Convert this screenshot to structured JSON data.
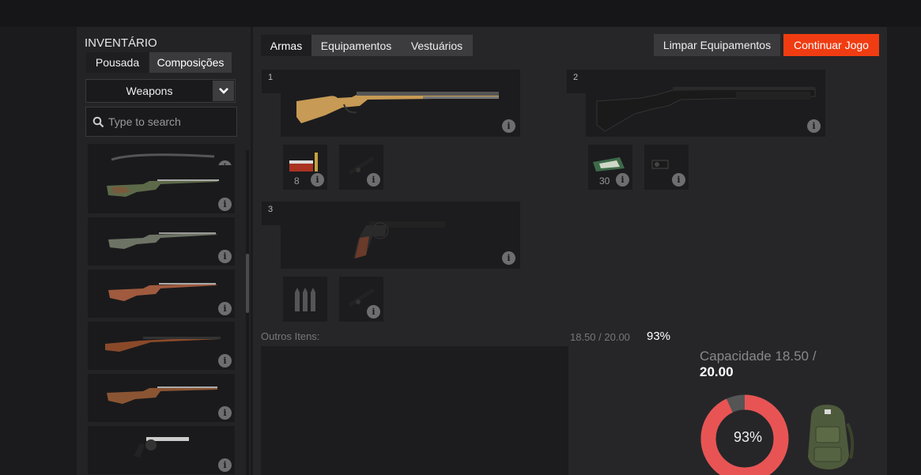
{
  "sidebar": {
    "title": "INVENTÁRIO",
    "subtabs": [
      "Pousada",
      "Composições"
    ],
    "category": "Weapons",
    "search_placeholder": "Type to search",
    "info_glyph": "i"
  },
  "tabs": [
    "Armas",
    "Equipamentos",
    "Vestuários"
  ],
  "actions": {
    "clear": "Limpar Equipamentos",
    "continue": "Continuar Jogo"
  },
  "slots": [
    {
      "number": "1",
      "attachments": [
        {
          "qty": "8"
        },
        {
          "qty": ""
        }
      ]
    },
    {
      "number": "2",
      "attachments": [
        {
          "qty": "30"
        },
        {
          "qty": ""
        }
      ]
    },
    {
      "number": "3",
      "attachments": [
        {
          "qty": ""
        },
        {
          "qty": ""
        }
      ]
    }
  ],
  "other_items_label": "Outros Itens:",
  "weight": {
    "text": "18.50 / 20.00",
    "percent_text": "93%",
    "capacity_label": "Capacidade 18.50 /",
    "capacity_max": "20.00",
    "fill_fraction": 0.93
  },
  "colors": {
    "accent": "#f03c12",
    "donut_fill": "#e85454",
    "donut_empty": "#555555"
  }
}
